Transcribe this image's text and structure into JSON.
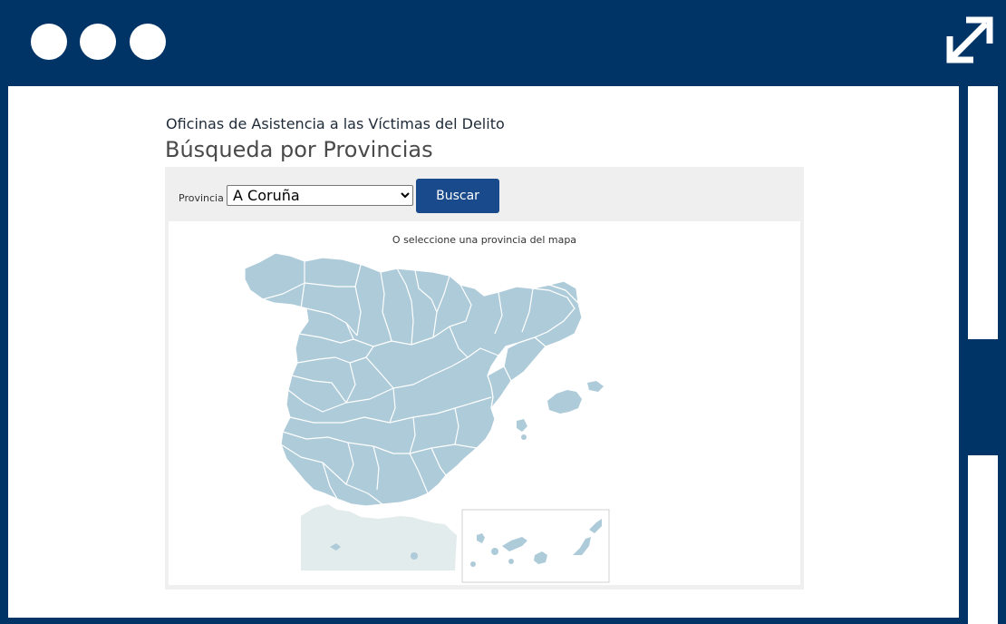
{
  "window": {
    "controls": [
      "window-dot",
      "window-dot",
      "window-dot"
    ],
    "expand_icon": "expand-arrows-icon"
  },
  "page": {
    "subtitle": "Oficinas de Asistencia a las Víctimas del Delito",
    "title": "Búsqueda por Provincias"
  },
  "search": {
    "province_label": "Provincia",
    "selected_province": "A Coruña",
    "button_label": "Buscar"
  },
  "map": {
    "instruction": "O seleccione una provincia del mapa",
    "fill_color": "#aecbd9",
    "border_color": "#ffffff",
    "africa_color": "#e3ecec"
  }
}
